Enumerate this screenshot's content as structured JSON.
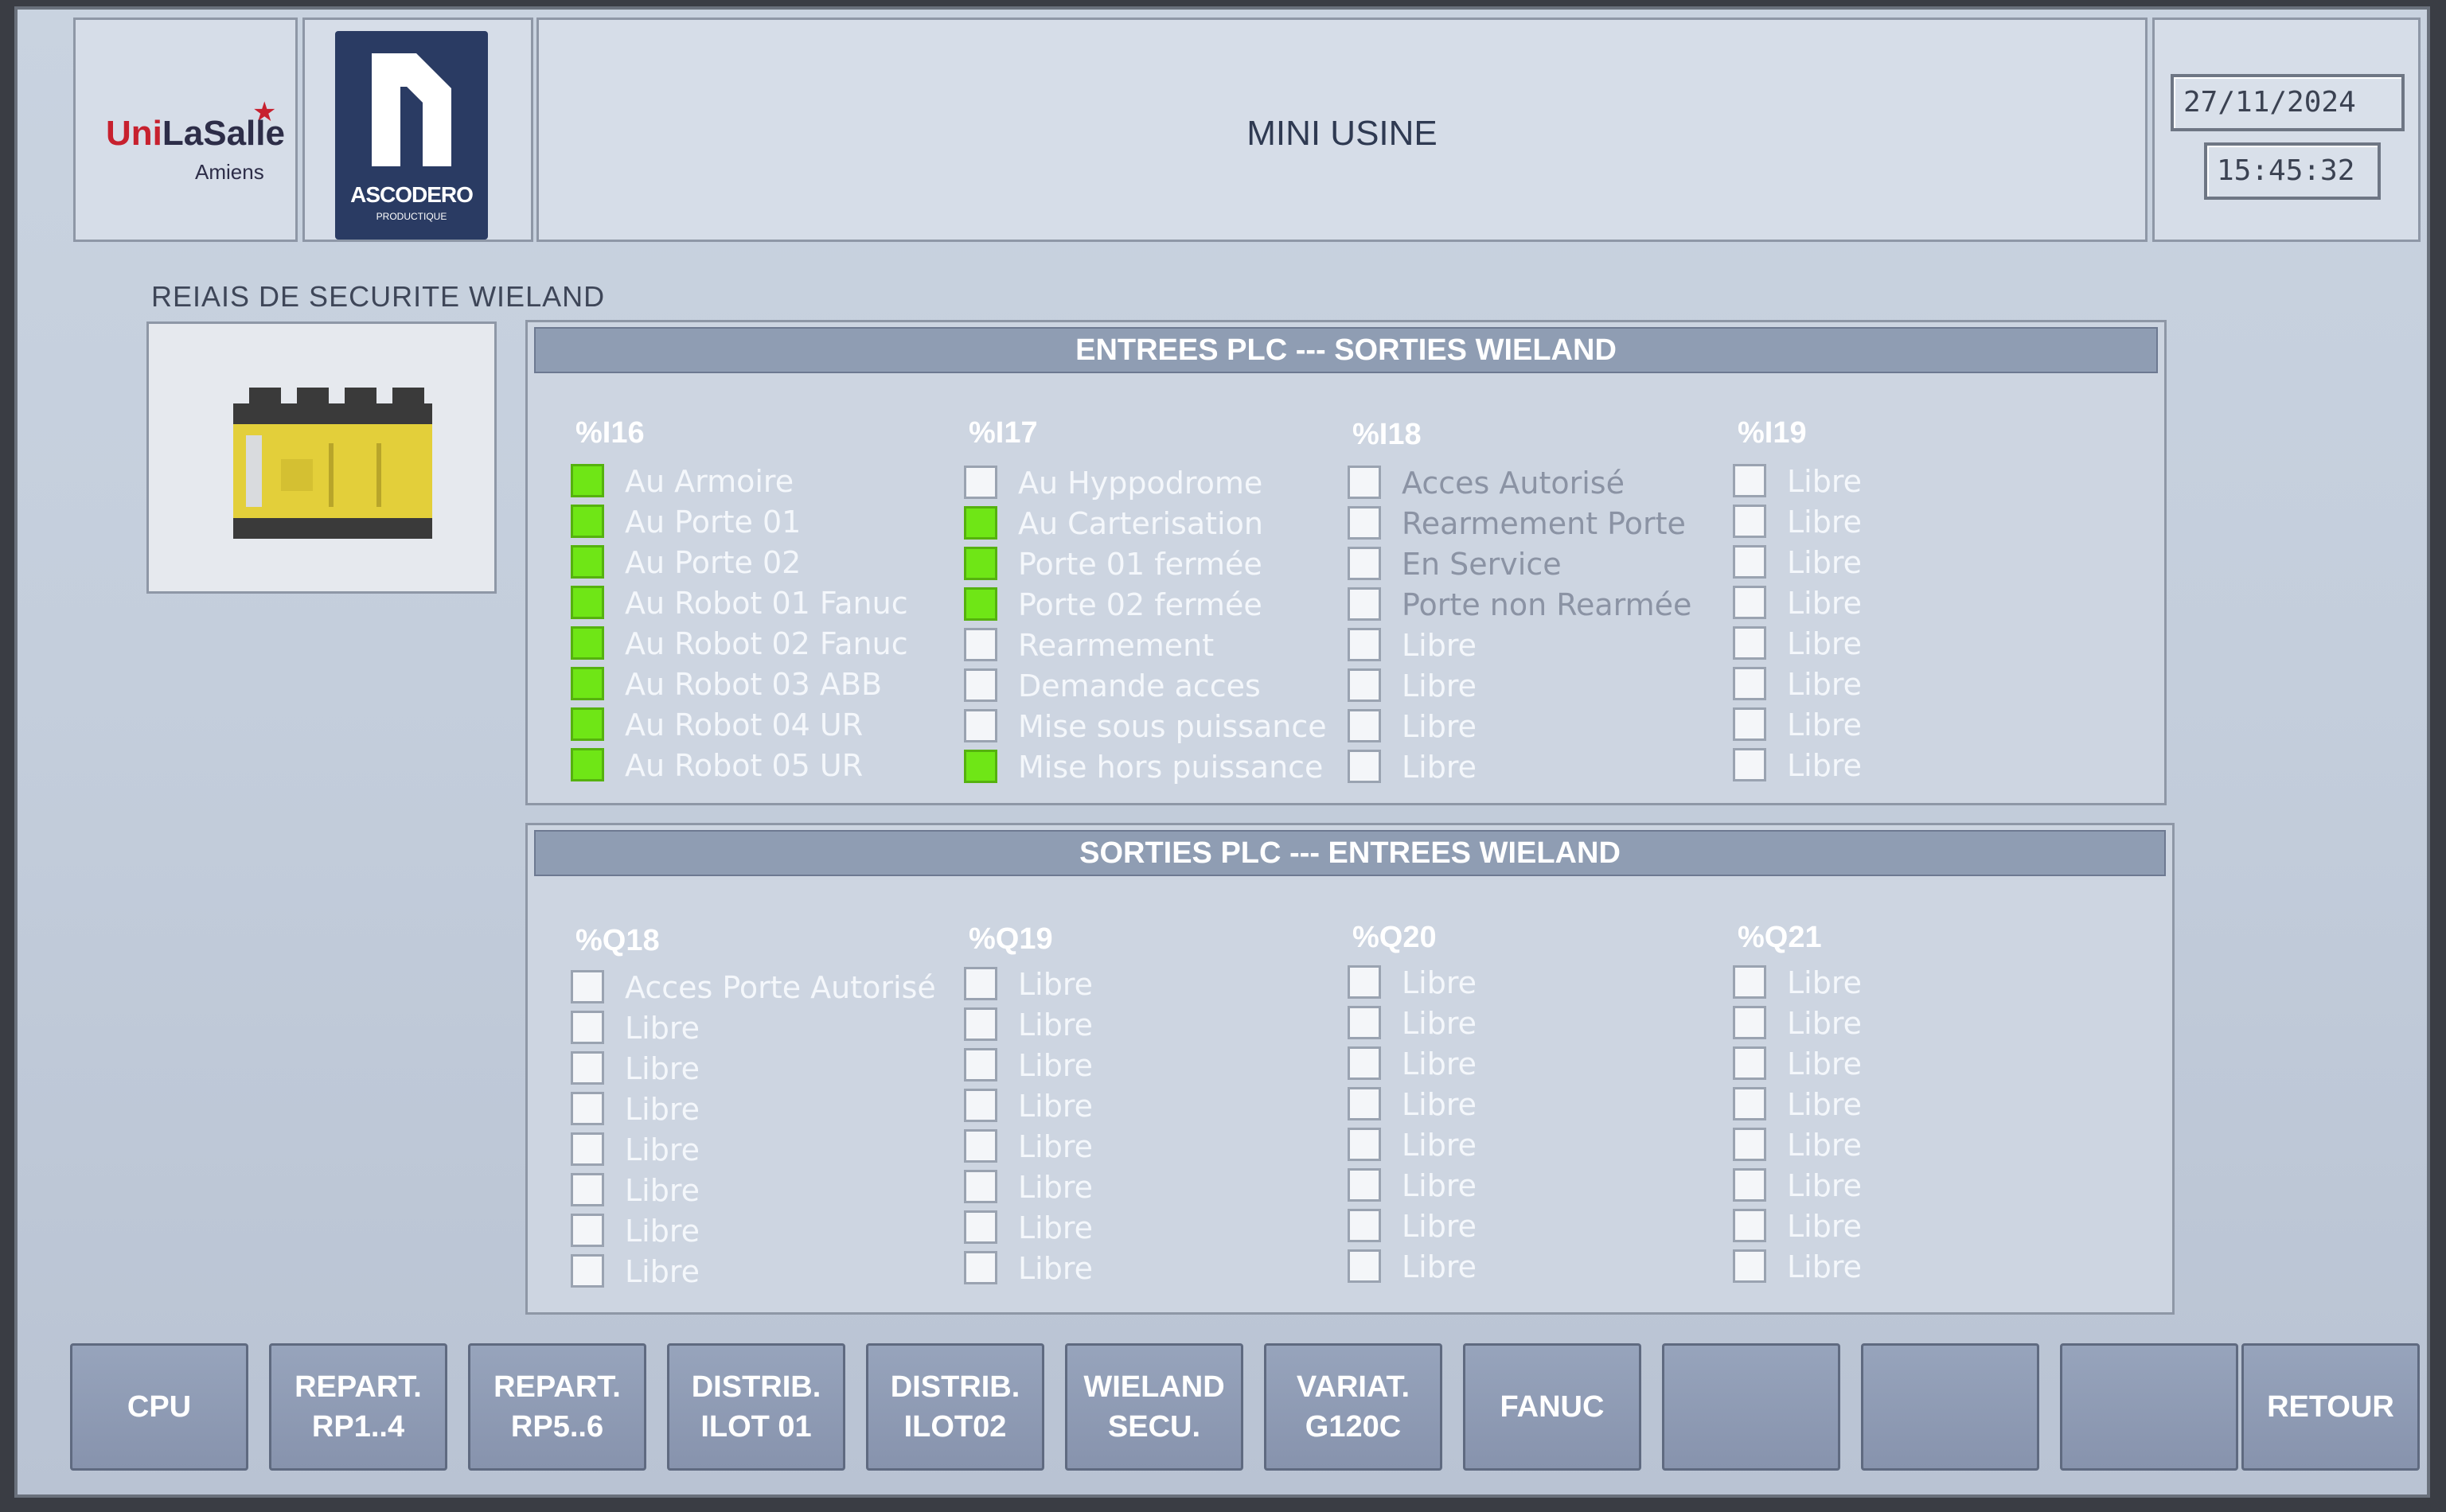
{
  "header": {
    "unilasalle": {
      "uni": "Uni",
      "lasalle": "LaSalle",
      "city": "Amiens"
    },
    "ascodero": {
      "name": "ASCODERO",
      "tagline": "PRODUCTIQUE"
    },
    "title": "MINI USINE",
    "date": "27/11/2024",
    "time": "15:45:32"
  },
  "section_label": "REIAIS DE SECURITE WIELAND",
  "inputs": {
    "header": "ENTREES PLC ---  SORTIES WIELAND",
    "columns": [
      {
        "title": "%I16",
        "items": [
          {
            "label": "Au Armoire",
            "on": true
          },
          {
            "label": "Au Porte 01",
            "on": true
          },
          {
            "label": "Au Porte 02",
            "on": true
          },
          {
            "label": "Au Robot 01 Fanuc",
            "on": true
          },
          {
            "label": "Au Robot 02 Fanuc",
            "on": true
          },
          {
            "label": "Au Robot 03 ABB",
            "on": true
          },
          {
            "label": "Au Robot 04 UR",
            "on": true
          },
          {
            "label": "Au Robot 05 UR",
            "on": true
          }
        ]
      },
      {
        "title": "%I17",
        "items": [
          {
            "label": "Au Hyppodrome",
            "on": false
          },
          {
            "label": "Au Carterisation",
            "on": true
          },
          {
            "label": "Porte 01 fermée",
            "on": true
          },
          {
            "label": "Porte 02 fermée",
            "on": true
          },
          {
            "label": "Rearmement",
            "on": false
          },
          {
            "label": "Demande acces",
            "on": false
          },
          {
            "label": "Mise sous puissance",
            "on": false
          },
          {
            "label": "Mise hors puissance",
            "on": true
          }
        ]
      },
      {
        "title": "%I18",
        "items": [
          {
            "label": "Acces Autorisé",
            "on": false
          },
          {
            "label": "Rearmement Porte",
            "on": false
          },
          {
            "label": "En Service",
            "on": false
          },
          {
            "label": "Porte non Rearmée",
            "on": false
          },
          {
            "label": "Libre",
            "on": false
          },
          {
            "label": "Libre",
            "on": false
          },
          {
            "label": "Libre",
            "on": false
          },
          {
            "label": "Libre",
            "on": false
          }
        ]
      },
      {
        "title": "%I19",
        "items": [
          {
            "label": "Libre",
            "on": false
          },
          {
            "label": "Libre",
            "on": false
          },
          {
            "label": "Libre",
            "on": false
          },
          {
            "label": "Libre",
            "on": false
          },
          {
            "label": "Libre",
            "on": false
          },
          {
            "label": "Libre",
            "on": false
          },
          {
            "label": "Libre",
            "on": false
          },
          {
            "label": "Libre",
            "on": false
          }
        ]
      }
    ]
  },
  "outputs": {
    "header": "SORTIES PLC ---  ENTREES WIELAND",
    "columns": [
      {
        "title": "%Q18",
        "items": [
          {
            "label": "Acces Porte Autorisé",
            "on": false
          },
          {
            "label": "Libre",
            "on": false
          },
          {
            "label": "Libre",
            "on": false
          },
          {
            "label": "Libre",
            "on": false
          },
          {
            "label": "Libre",
            "on": false
          },
          {
            "label": "Libre",
            "on": false
          },
          {
            "label": "Libre",
            "on": false
          },
          {
            "label": "Libre",
            "on": false
          }
        ]
      },
      {
        "title": "%Q19",
        "items": [
          {
            "label": "Libre",
            "on": false
          },
          {
            "label": "Libre",
            "on": false
          },
          {
            "label": "Libre",
            "on": false
          },
          {
            "label": "Libre",
            "on": false
          },
          {
            "label": "Libre",
            "on": false
          },
          {
            "label": "Libre",
            "on": false
          },
          {
            "label": "Libre",
            "on": false
          },
          {
            "label": "Libre",
            "on": false
          }
        ]
      },
      {
        "title": "%Q20",
        "items": [
          {
            "label": "Libre",
            "on": false
          },
          {
            "label": "Libre",
            "on": false
          },
          {
            "label": "Libre",
            "on": false
          },
          {
            "label": "Libre",
            "on": false
          },
          {
            "label": "Libre",
            "on": false
          },
          {
            "label": "Libre",
            "on": false
          },
          {
            "label": "Libre",
            "on": false
          },
          {
            "label": "Libre",
            "on": false
          }
        ]
      },
      {
        "title": "%Q21",
        "items": [
          {
            "label": "Libre",
            "on": false
          },
          {
            "label": "Libre",
            "on": false
          },
          {
            "label": "Libre",
            "on": false
          },
          {
            "label": "Libre",
            "on": false
          },
          {
            "label": "Libre",
            "on": false
          },
          {
            "label": "Libre",
            "on": false
          },
          {
            "label": "Libre",
            "on": false
          },
          {
            "label": "Libre",
            "on": false
          }
        ]
      }
    ]
  },
  "footer_buttons": [
    {
      "label": "CPU"
    },
    {
      "label": "REPART.\nRP1..4"
    },
    {
      "label": "REPART.\nRP5..6"
    },
    {
      "label": "DISTRIB.\nILOT 01"
    },
    {
      "label": "DISTRIB.\nILOT02"
    },
    {
      "label": "WIELAND\nSECU."
    },
    {
      "label": "VARIAT.\nG120C"
    },
    {
      "label": "FANUC"
    },
    {
      "label": ""
    },
    {
      "label": ""
    },
    {
      "label": ""
    },
    {
      "label": "RETOUR"
    }
  ],
  "colors": {
    "on": "#6fe616",
    "off": "#f4f6f9",
    "button": "#8f9db3",
    "header": "#8f9db3"
  }
}
